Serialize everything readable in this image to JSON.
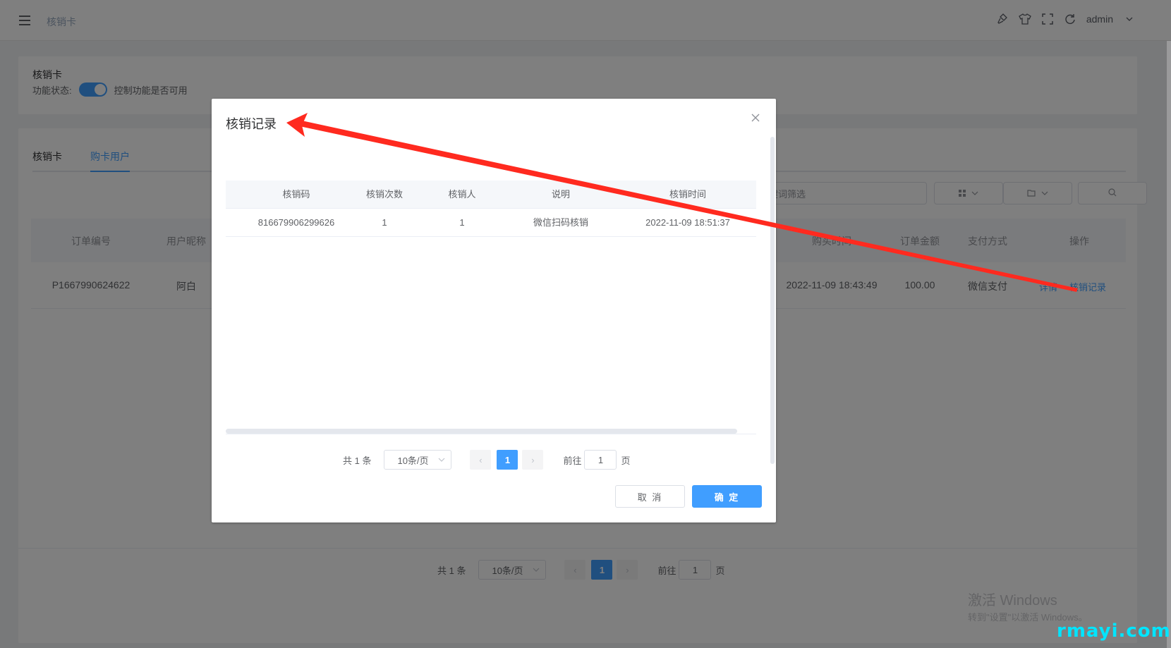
{
  "header": {
    "breadcrumb": "核销卡",
    "user": "admin",
    "icons": [
      "brush-icon",
      "shirt-icon",
      "fullscreen-icon",
      "refresh-icon"
    ]
  },
  "settings_card": {
    "title": "核销卡",
    "status_label": "功能状态:",
    "switch_on": true,
    "status_desc": "控制功能是否可用"
  },
  "tabs": [
    {
      "label": "核销卡",
      "active": false
    },
    {
      "label": "购卡用户",
      "active": true
    }
  ],
  "filters": {
    "keyword_placeholder": "关键词筛选"
  },
  "main_table": {
    "columns": [
      "订单编号",
      "用户昵称",
      "购买时间",
      "订单金额",
      "支付方式",
      "操作"
    ],
    "rows": [
      {
        "order_no": "P1667990624622",
        "nickname": "阿白",
        "buy_time": "2022-11-09 18:43:49",
        "amount": "100.00",
        "pay_method": "微信支付",
        "actions": [
          "详情",
          "核销记录"
        ]
      }
    ]
  },
  "main_pager": {
    "total": "共 1 条",
    "page_size": "10条/页",
    "current_page": "1",
    "goto_label": "前往",
    "goto_value": "1",
    "unit": "页"
  },
  "dialog": {
    "title": "核销记录",
    "columns": [
      "核销码",
      "核销次数",
      "核销人",
      "说明",
      "核销时间"
    ],
    "rows": [
      {
        "code": "816679906299626",
        "count": "1",
        "operator": "1",
        "desc": "微信扫码核销",
        "time": "2022-11-09 18:51:37"
      }
    ],
    "pager": {
      "total": "共 1 条",
      "page_size": "10条/页",
      "current_page": "1",
      "goto_label": "前往",
      "goto_value": "1",
      "unit": "页"
    },
    "cancel_label": "取 消",
    "ok_label": "确 定"
  },
  "watermark": {
    "line1": "激活 Windows",
    "line2": "转到\"设置\"以激活 Windows。",
    "brand": "rmayi.com"
  },
  "annotation": {
    "arrow_color": "#ff2a1f"
  }
}
